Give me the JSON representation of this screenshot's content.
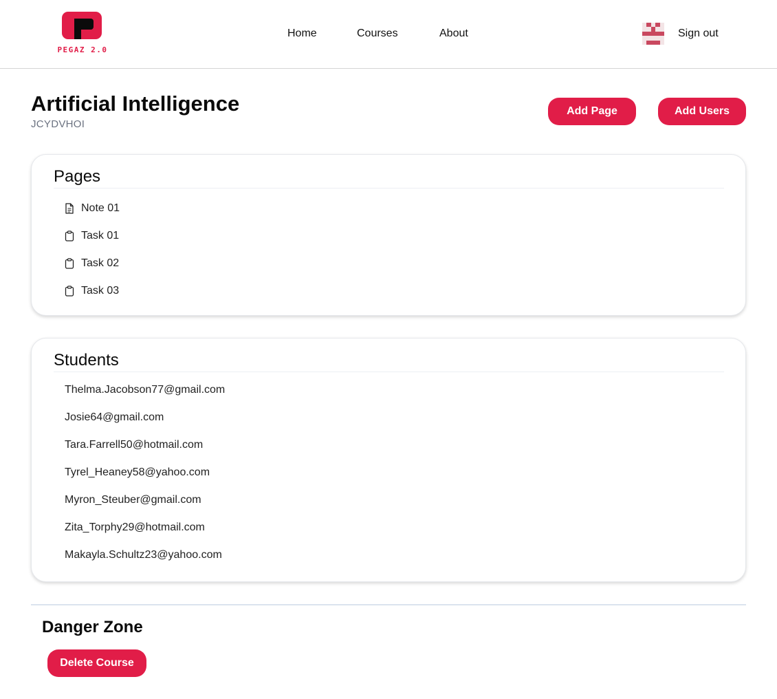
{
  "header": {
    "logo_text": "PEGAZ 2.0",
    "nav": [
      {
        "label": "Home"
      },
      {
        "label": "Courses"
      },
      {
        "label": "About"
      }
    ],
    "avatar_icon": "pixel-avatar-icon",
    "signout_label": "Sign out"
  },
  "course": {
    "title": "Artificial Intelligence",
    "code": "JCYDVHOI",
    "add_page_label": "Add Page",
    "add_users_label": "Add Users"
  },
  "pages": {
    "title": "Pages",
    "items": [
      {
        "label": "Note 01",
        "icon": "document-icon"
      },
      {
        "label": "Task 01",
        "icon": "clipboard-icon"
      },
      {
        "label": "Task 02",
        "icon": "clipboard-icon"
      },
      {
        "label": "Task 03",
        "icon": "clipboard-icon"
      }
    ]
  },
  "students": {
    "title": "Students",
    "items": [
      "Thelma.Jacobson77@gmail.com",
      "Josie64@gmail.com",
      "Tara.Farrell50@hotmail.com",
      "Tyrel_Heaney58@yahoo.com",
      "Myron_Steuber@gmail.com",
      "Zita_Torphy29@hotmail.com",
      "Makayla.Schultz23@yahoo.com"
    ]
  },
  "danger": {
    "title": "Danger Zone",
    "delete_label": "Delete Course"
  },
  "colors": {
    "accent": "#e11d48",
    "muted_text": "#6b7280",
    "avatar": "#c9485f"
  }
}
